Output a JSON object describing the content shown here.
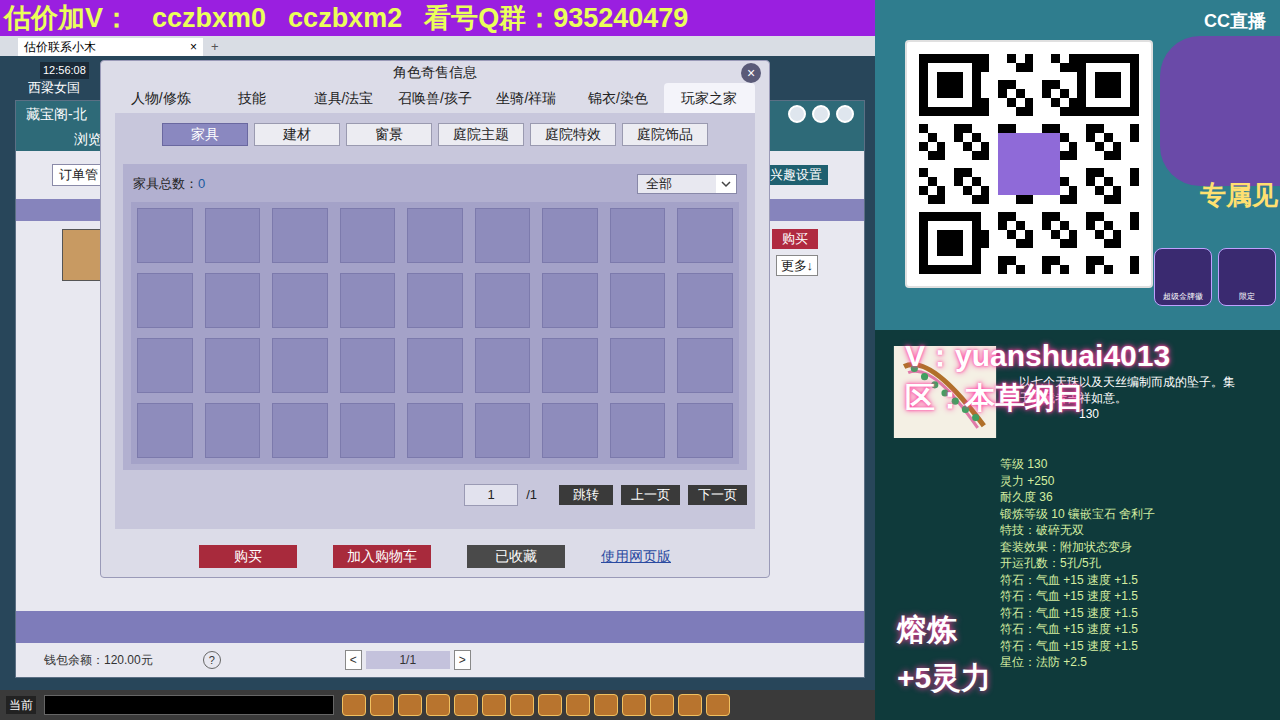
{
  "banner": {
    "segments": [
      "估价加V：",
      "cczbxm0",
      "cczbxm2",
      "看号Q群：935240479"
    ]
  },
  "browser_tab": {
    "title": "估价联系小木",
    "close": "×",
    "new": "+"
  },
  "game": {
    "time": "12:56:08",
    "location": "西梁女国",
    "chat_channel": "当前"
  },
  "back_window": {
    "title": "藏宝阁-北",
    "browse": "浏览",
    "orders": "订单管",
    "interest": "兴趣设置",
    "buy": "购买",
    "more": "更多↓",
    "wallet": "钱包余额：120.00元",
    "help": "?",
    "page": "1/1",
    "prev": "<",
    "next": ">"
  },
  "dialog": {
    "title": "角色奇售信息",
    "close": "×",
    "tabs": [
      {
        "label": "人物/修炼",
        "selected": false
      },
      {
        "label": "技能",
        "selected": false
      },
      {
        "label": "道具/法宝",
        "selected": false
      },
      {
        "label": "召唤兽/孩子",
        "selected": false
      },
      {
        "label": "坐骑/祥瑞",
        "selected": false
      },
      {
        "label": "锦衣/染色",
        "selected": false
      },
      {
        "label": "玩家之家",
        "selected": true
      }
    ],
    "subtabs": [
      {
        "label": "家具",
        "selected": true
      },
      {
        "label": "建材",
        "selected": false
      },
      {
        "label": "窗景",
        "selected": false
      },
      {
        "label": "庭院主题",
        "selected": false
      },
      {
        "label": "庭院特效",
        "selected": false
      },
      {
        "label": "庭院饰品",
        "selected": false
      }
    ],
    "count_label": "家具总数：",
    "count": "0",
    "filter": "全部",
    "slots": [
      {
        "empty": true
      },
      {
        "empty": true
      },
      {
        "empty": true
      },
      {
        "empty": true
      },
      {
        "empty": true
      },
      {
        "empty": true
      },
      {
        "empty": true
      },
      {
        "empty": true
      },
      {
        "empty": true
      },
      {
        "empty": true
      },
      {
        "empty": true
      },
      {
        "empty": true
      },
      {
        "empty": true
      },
      {
        "empty": true
      },
      {
        "empty": true
      },
      {
        "empty": true
      },
      {
        "empty": true
      },
      {
        "empty": true
      },
      {
        "empty": true
      },
      {
        "empty": true
      },
      {
        "empty": true
      },
      {
        "empty": true
      },
      {
        "empty": true
      },
      {
        "empty": true
      },
      {
        "empty": true
      },
      {
        "empty": true
      },
      {
        "empty": true
      },
      {
        "empty": true
      },
      {
        "empty": true
      },
      {
        "empty": true
      },
      {
        "empty": true
      },
      {
        "empty": true
      },
      {
        "empty": true
      },
      {
        "empty": true
      },
      {
        "empty": true
      },
      {
        "empty": true
      }
    ],
    "page_input": "1",
    "page_total": "/1",
    "jump": "跳转",
    "prev": "上一页",
    "next": "下一页",
    "buttons": [
      {
        "label": "购买",
        "kind": "primary"
      },
      {
        "label": "加入购物车",
        "kind": "primary"
      },
      {
        "label": "已收藏",
        "kind": "dark"
      },
      {
        "label": "使用网页版",
        "kind": "link"
      }
    ]
  },
  "promo": {
    "brand": "CC直播",
    "headline": "专属见",
    "badges": [
      "超级金牌徽",
      "限定"
    ]
  },
  "stream_overlay": {
    "contact": "V：yuanshuai4013",
    "server": "区：本草纲目",
    "refine": "熔炼",
    "refine_bonus": "+5灵力"
  },
  "item": {
    "description": [
      "以七个天珠以及天丝编制而成的坠子。集",
      "子佩戴者吉祥如意。"
    ],
    "level_tag": "130",
    "stats": [
      "等级 130",
      "灵力 +250",
      "耐久度 36",
      "锻炼等级 10 镶嵌宝石 舍利子",
      "特技：破碎无双",
      "套装效果：附加状态变身",
      "开运孔数：5孔/5孔",
      "符石：气血 +15 速度 +1.5",
      "符石：气血 +15 速度 +1.5",
      "符石：气血 +15 速度 +1.5",
      "符石：气血 +15 速度 +1.5",
      "符石：气血 +15 速度 +1.5",
      "星位：法防 +2.5"
    ]
  }
}
